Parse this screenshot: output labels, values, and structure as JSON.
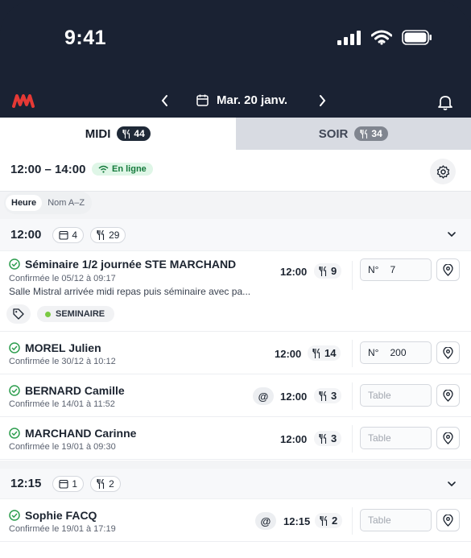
{
  "status_bar": {
    "time": "9:41"
  },
  "header": {
    "date": "Mar. 20 janv."
  },
  "colors": {
    "dark_bg": "#1a2233",
    "accent": "#e53935",
    "online_green": "#157a3c"
  },
  "tabs": [
    {
      "label": "MIDI",
      "count": "44",
      "active": true
    },
    {
      "label": "SOIR",
      "count": "34",
      "active": false
    }
  ],
  "service": {
    "range": "12:00 – 14:00",
    "status": "En ligne"
  },
  "sort": {
    "options": [
      "Heure",
      "Nom A–Z"
    ],
    "selected": "Heure"
  },
  "groups": [
    {
      "time": "12:00",
      "bookings": "4",
      "covers": "29",
      "rows": [
        {
          "name": "Séminaire 1/2 journée STE MARCHAND",
          "confirm": "Confirmée le 05/12 à 09:17",
          "note": "Salle Mistral arrivée midi repas puis séminaire avec pa...",
          "time": "12:00",
          "covers": "9",
          "table_prefix": "N°",
          "table": "7",
          "tag": "SEMINAIRE"
        },
        {
          "name": "MOREL Julien",
          "confirm": "Confirmée le 30/12 à 10:12",
          "time": "12:00",
          "covers": "14",
          "table_prefix": "N°",
          "table": "200"
        },
        {
          "name": "BERNARD Camille",
          "confirm": "Confirmée le 14/01 à 11:52",
          "time": "12:00",
          "covers": "3",
          "online": "@",
          "table_placeholder": "Table"
        },
        {
          "name": "MARCHAND Carinne",
          "confirm": "Confirmée le 19/01 à 09:30",
          "time": "12:00",
          "covers": "3",
          "table_placeholder": "Table"
        }
      ]
    },
    {
      "time": "12:15",
      "bookings": "1",
      "covers": "2",
      "rows": [
        {
          "name": "Sophie FACQ",
          "confirm": "Confirmée le 19/01 à 17:19",
          "time": "12:15",
          "covers": "2",
          "online": "@",
          "table_placeholder": "Table"
        }
      ]
    }
  ]
}
